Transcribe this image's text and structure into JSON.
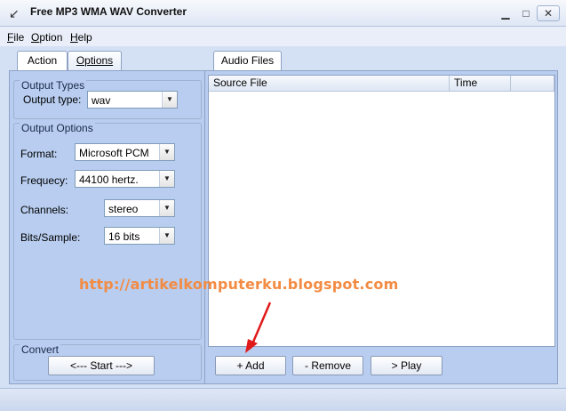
{
  "window": {
    "title": "Free MP3 WMA WAV Converter",
    "min": "▁",
    "max": "□",
    "close": "✕"
  },
  "menu": [
    {
      "first": "F",
      "rest": "ile"
    },
    {
      "first": "O",
      "rest": "ption"
    },
    {
      "first": "H",
      "rest": "elp"
    }
  ],
  "tabs_left": {
    "action": "Action",
    "options": "Options"
  },
  "output_types": {
    "title": "Output Types",
    "type_label": "Output type:",
    "type_value": "wav"
  },
  "output_options": {
    "title": "Output Options",
    "format_label": "Format:",
    "format_value": "Microsoft PCM",
    "freq_label": "Frequecy:",
    "freq_value": "44100 hertz.",
    "channels_label": "Channels:",
    "channels_value": "stereo",
    "bits_label": "Bits/Sample:",
    "bits_value": "16 bits"
  },
  "convert": {
    "title": "Convert",
    "start": "<--- Start --->"
  },
  "tabs_right": {
    "audio_files": "Audio Files"
  },
  "list": {
    "columns": [
      "Source File",
      "Time"
    ]
  },
  "buttons": {
    "add": "+ Add",
    "remove": "- Remove",
    "play": "> Play"
  },
  "watermark": "http://artikelkomputerku.blogspot.com",
  "colors": {
    "watermark": "#f28b43",
    "arrow": "#e01a1a"
  }
}
